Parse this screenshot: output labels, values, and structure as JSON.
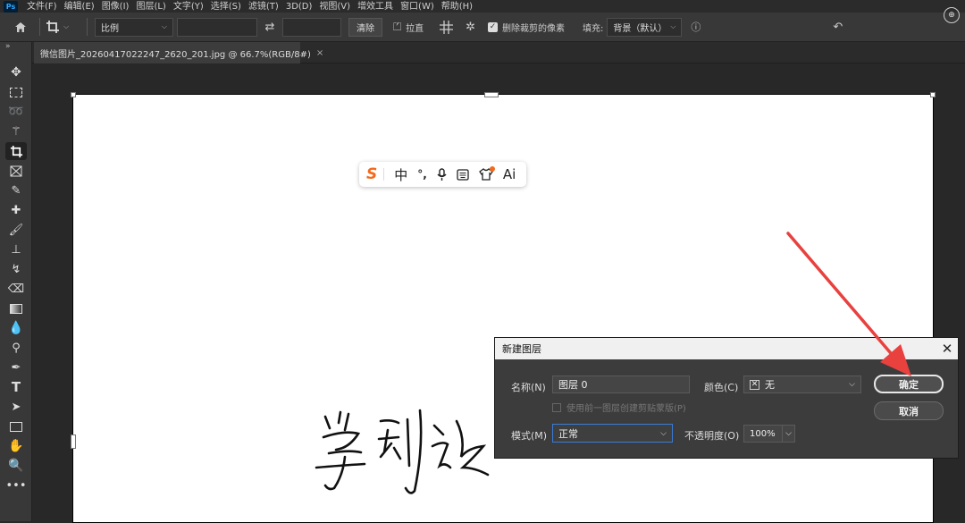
{
  "app": {
    "logo": "Ps"
  },
  "menubar": {
    "items": [
      "文件(F)",
      "编辑(E)",
      "图像(I)",
      "图层(L)",
      "文字(Y)",
      "选择(S)",
      "滤镜(T)",
      "3D(D)",
      "视图(V)",
      "增效工具",
      "窗口(W)",
      "帮助(H)"
    ]
  },
  "options": {
    "ratio_select": "比例",
    "clear_button": "清除",
    "straighten_label": "拉直",
    "delete_cropped_label": "删除裁剪的像素",
    "delete_cropped_checked": true,
    "fill_label": "填充:",
    "fill_select": "背景（默认）"
  },
  "document_tab": {
    "title": "微信图片_20260417022247_2620_201.jpg @ 66.7%(RGB/8#)",
    "close": "×"
  },
  "tools": [
    "move-tool",
    "marquee-tool",
    "lasso-tool",
    "magic-wand-tool",
    "crop-tool",
    "frame-tool",
    "eyedropper-tool",
    "healing-brush-tool",
    "brush-tool",
    "clone-stamp-tool",
    "history-brush-tool",
    "eraser-tool",
    "gradient-tool",
    "blur-tool",
    "dodge-tool",
    "pen-tool",
    "type-tool",
    "path-selection-tool",
    "rectangle-tool",
    "hand-tool",
    "zoom-tool",
    "more-tools"
  ],
  "ime_toolbar": {
    "logo": "S",
    "items": [
      "中",
      "°,",
      "🎙",
      "⌨",
      "👕",
      "Ai"
    ]
  },
  "dialog": {
    "title": "新建图层",
    "close": "✕",
    "name_label": "名称(N)",
    "name_value": "图层 0",
    "color_label": "颜色(C)",
    "color_value": "无",
    "clipping_label": "使用前一图层创建剪贴蒙版(P)",
    "mode_label": "模式(M)",
    "mode_value": "正常",
    "opacity_label": "不透明度(O)",
    "opacity_value": "100%",
    "ok_button": "确定",
    "cancel_button": "取消"
  },
  "colors": {
    "arrow": "#e8413e",
    "mode_border": "#3a7bd5",
    "ime_logo": "#f26a1b"
  }
}
